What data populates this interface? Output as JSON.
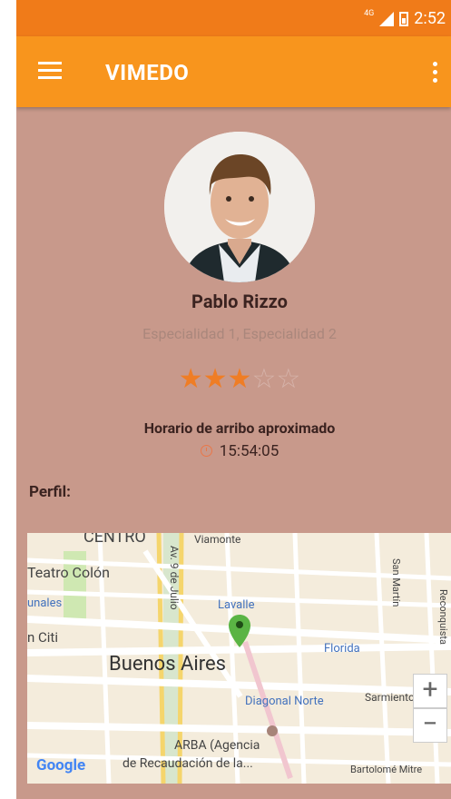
{
  "status": {
    "network": "4G",
    "time": "2:52"
  },
  "toolbar": {
    "title": "VIMEDO"
  },
  "profile": {
    "name": "Pablo Rizzo",
    "specialties": "Especialidad 1, Especialidad 2",
    "rating": 3,
    "rating_max": 5,
    "arrival_label": "Horario de arribo aproximado",
    "arrival_time": "15:54:05",
    "section_label": "Perfil:"
  },
  "map": {
    "labels": {
      "centro": "CENTRO",
      "viamonte": "Viamonte",
      "teatro": "Teatro Colón",
      "nueve_julio": "Av. 9 de Julio",
      "tribunales": "unales",
      "lavalle": "Lavalle",
      "san_martin": "San Martín",
      "reconquista": "Reconquista",
      "citi": "n Citi",
      "florida": "Florida",
      "buenos_aires": "Buenos Aires",
      "diagonal": "Diagonal Norte",
      "sarmiento": "Sarmiento",
      "arba_1": "ARBA (Agencia",
      "arba_2": "de Recaudación de la...",
      "bartolome": "Bartolomé Mitre",
      "google": "Google"
    },
    "zoom_in": "+",
    "zoom_out": "−"
  },
  "colors": {
    "statusbar": "#f07b19",
    "toolbar": "#f8951d",
    "background": "#c8998b",
    "accent": "#ef7d25"
  }
}
